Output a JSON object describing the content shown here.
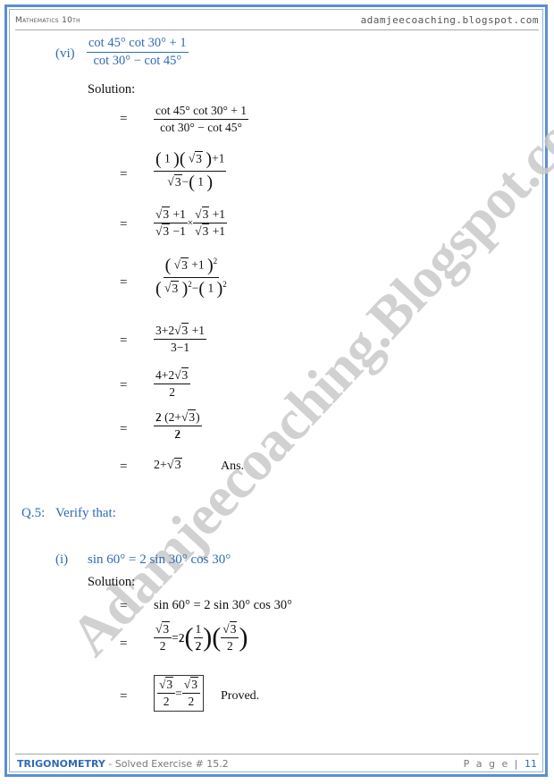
{
  "header": {
    "subject": "Mathematics 10th",
    "site": "adamjeecoaching.blogspot.com"
  },
  "watermark": "Adamjeecoaching.Blogspot.com",
  "part_vi": {
    "label": "(vi)",
    "numerator": "cot 45° cot 30° + 1",
    "denominator": "cot 30° − cot 45°",
    "solution_label": "Solution:",
    "steps": [
      {
        "eq": "=",
        "num": "cot 45° cot 30° + 1",
        "den": "cot 30° − cot 45°"
      },
      {
        "eq": "=",
        "num": "(1)(√3)+1",
        "den": "√3−(1)"
      },
      {
        "eq": "=",
        "num1": "√3+1",
        "den1": "√3−1",
        "op": "×",
        "num2": "√3+1",
        "den2": "√3+1"
      },
      {
        "eq": "=",
        "num": "(√3+1)²",
        "den": "(√3)²−(1)²"
      },
      {
        "eq": "=",
        "num": "3+2√3+1",
        "den": "3−1"
      },
      {
        "eq": "=",
        "num": "4+2√3",
        "den": "2"
      },
      {
        "eq": "=",
        "num_cancel": "2",
        "num_rest": "(2+√3)",
        "den_cancel": "2"
      },
      {
        "eq": "=",
        "result": "2+√3",
        "suffix": "Ans."
      }
    ]
  },
  "q5": {
    "label": "Q.5:",
    "title": "Verify that:",
    "part_i": {
      "label": "(i)",
      "statement": "sin 60° = 2 sin 30° cos 30°",
      "solution_label": "Solution:",
      "steps": [
        {
          "eq": "=",
          "text": "sin 60° = 2 sin 30° cos 30°"
        },
        {
          "eq": "=",
          "lhs_num": "√3",
          "lhs_den": "2",
          "equals": "=",
          "coef_cancel": "2",
          "f1_num": "1",
          "f1_den_cancel": "2",
          "f2_num": "√3",
          "f2_den": "2"
        },
        {
          "eq": "=",
          "lhs_num": "√3",
          "lhs_den": "2",
          "equals": "=",
          "rhs_num": "√3",
          "rhs_den": "2",
          "suffix": "Proved."
        }
      ]
    }
  },
  "footer": {
    "topic": "TRIGONOMETRY",
    "subtitle": " - Solved Exercise # 15.2",
    "page_label": "P a g e | ",
    "page_number": "11"
  },
  "colors": {
    "accent": "#2f6ab7",
    "border": "#5b8fd3",
    "watermark": "#c9c9c9"
  }
}
